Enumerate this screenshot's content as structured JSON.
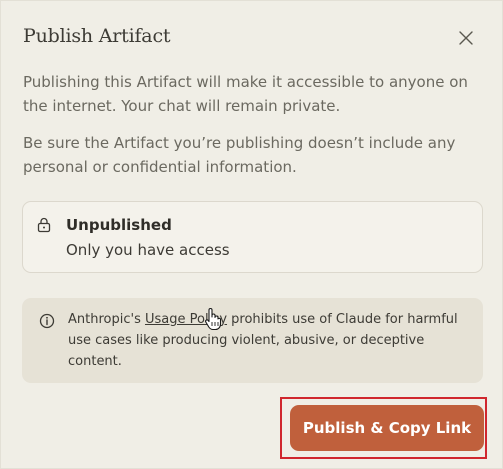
{
  "dialog": {
    "title": "Publish Artifact",
    "close_icon": "close-icon",
    "paragraph_1": "Publishing this Artifact will make it accessible to anyone on the internet. Your chat will remain private.",
    "paragraph_2": "Be sure the Artifact you’re publishing doesn’t include any personal or confidential information."
  },
  "status": {
    "icon": "lock-icon",
    "title": "Unpublished",
    "subtitle": "Only you have access"
  },
  "notice": {
    "icon": "info-icon",
    "prefix": "Anthropic's ",
    "link": "Usage Policy",
    "suffix": " prohibits use of Claude for harmful use cases like producing violent, abusive, or deceptive content."
  },
  "actions": {
    "publish_label": "Publish & Copy Link"
  },
  "colors": {
    "background": "#f0eee6",
    "button": "#c0603c",
    "highlight": "#d0272e"
  }
}
